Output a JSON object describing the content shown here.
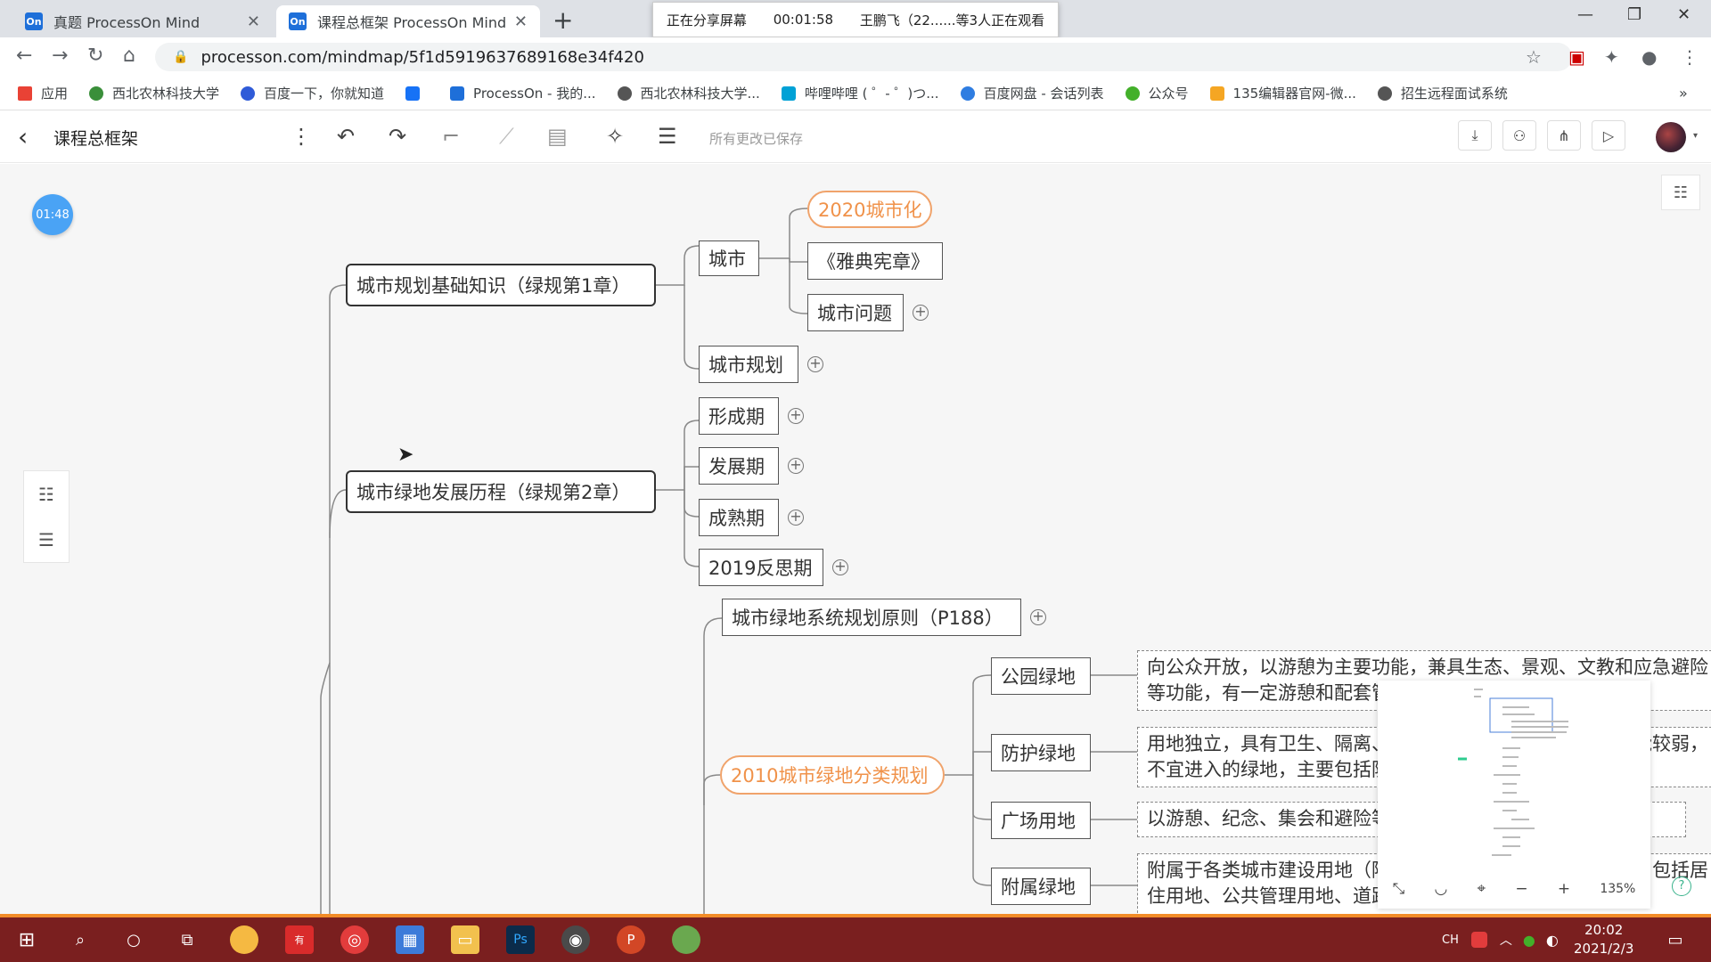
{
  "browser": {
    "tabs": [
      {
        "icon": "On",
        "title": "真题 ProcessOn Mind"
      },
      {
        "icon": "On",
        "title": "课程总框架 ProcessOn Mind"
      }
    ],
    "share_banner": {
      "status": "正在分享屏幕",
      "elapsed": "00:01:58",
      "viewers": "王鹏飞（22......等3人正在观看"
    },
    "url": "processon.com/mindmap/5f1d5919637689168e34f420",
    "bookmarks": [
      {
        "label": "应用",
        "color": "#e94235"
      },
      {
        "label": "西北农林科技大学",
        "color": "#3a8f3a"
      },
      {
        "label": "百度一下，你就知道",
        "color": "#2f5bd8"
      },
      {
        "label": "知",
        "color": "#1772f6"
      },
      {
        "label": "ProcessOn - 我的...",
        "color": "#1e6fd9"
      },
      {
        "label": "西北农林科技大学...",
        "color": "#555555"
      },
      {
        "label": "哔哩哔哩 ( ゜- ゜)つ...",
        "color": "#00a1d6"
      },
      {
        "label": "百度网盘 - 会话列表",
        "color": "#2f7de1"
      },
      {
        "label": "公众号",
        "color": "#43b02a"
      },
      {
        "label": "135编辑器官网-微...",
        "color": "#f5a623"
      },
      {
        "label": "招生远程面试系统",
        "color": "#555555"
      }
    ]
  },
  "app": {
    "doc_title": "课程总框架",
    "saved_status": "所有更改已保存",
    "timer": "01:48",
    "zoom": "135%"
  },
  "mindmap": {
    "chapter1": "城市规划基础知识（绿规第1章）",
    "city": "城市",
    "urbanization": "2020城市化",
    "athens": "《雅典宪章》",
    "city_problems": "城市问题",
    "city_planning": "城市规划",
    "chapter2": "城市绿地发展历程（绿规第2章）",
    "formation": "形成期",
    "development": "发展期",
    "maturity": "成熟期",
    "reflection": "2019反思期",
    "principle": "城市绿地系统规划原则（P188）",
    "classification": "2010城市绿地分类规划",
    "park": "公园绿地",
    "park_desc": "向公众开放，以游憩为主要功能，兼具生态、景观、文教和应急避险等功能，有一定游憩和配套管理服务设施。",
    "protective": "防护绿地",
    "protective_desc": "用地独立，具有卫生、隔离、安全、生态防护功能，游憩功能较弱，不宜进入的绿地，主要包括防护绿地等。",
    "square": "广场用地",
    "square_desc": "以游憩、纪念、集会和避险等功能为主的城市公共活动场地。",
    "attached": "附属绿地",
    "attached_desc": "附属于各类城市建设用地（除绿地与广场用地）的绿化用地，包括居住用地、公共管理用地、道路与交通设施用地等。"
  },
  "taskbar": {
    "lang": "CH",
    "time": "20:02",
    "date": "2021/2/3"
  }
}
